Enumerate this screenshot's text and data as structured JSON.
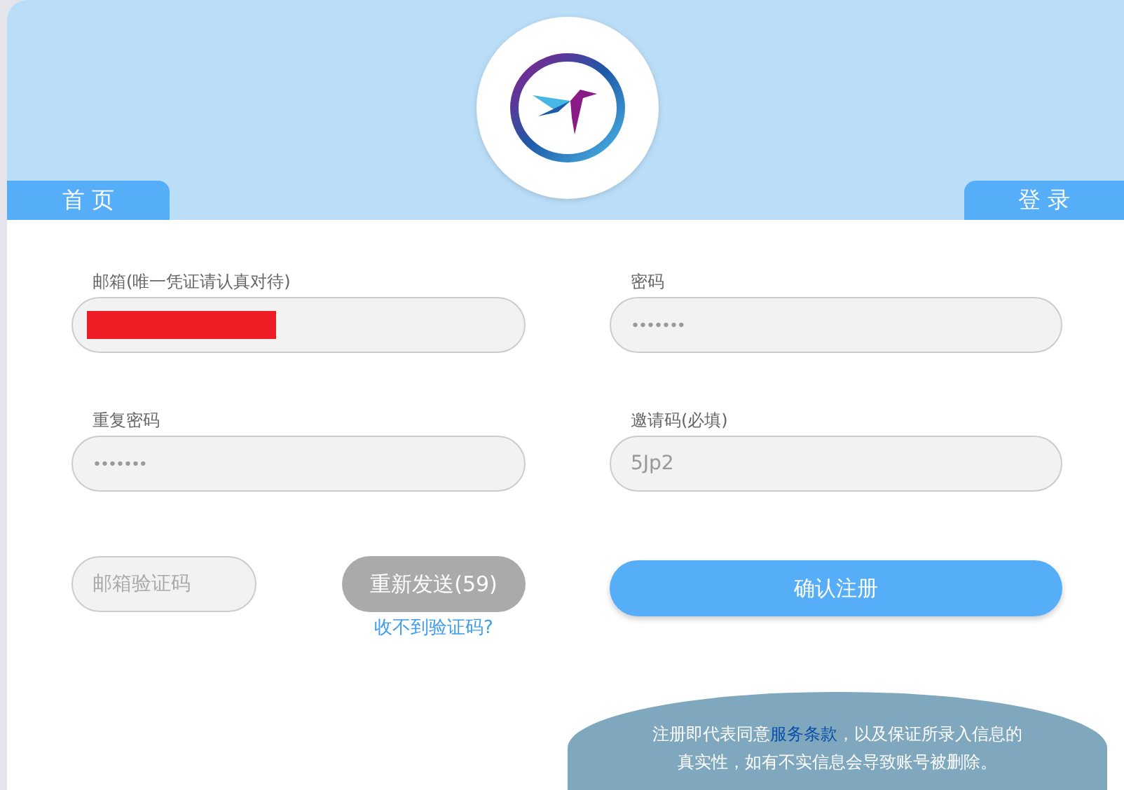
{
  "header": {
    "tabs": [
      {
        "label": "首 页"
      },
      {
        "label": "登 录"
      }
    ]
  },
  "form": {
    "fields": [
      {
        "label": "邮箱(唯一凭证请认真对待)",
        "kind": "redacted"
      },
      {
        "label": "密码",
        "kind": "masked",
        "value": "•••••••"
      },
      {
        "label": "重复密码",
        "kind": "masked",
        "value": "•••••••"
      },
      {
        "label": "邀请码(必填)",
        "kind": "text",
        "value": "5Jp2"
      }
    ],
    "code_field": {
      "placeholder": "邮箱验证码"
    },
    "resend_button": {
      "label": "重新发送(59)",
      "disabled": true
    },
    "help_link": "收不到验证码?",
    "submit_button": "确认注册"
  },
  "notice": {
    "before": "注册即代表同意",
    "link": "服务条款",
    "after": "，以及保证所录入信息的真实性，如有不实信息会导致账号被删除。"
  }
}
